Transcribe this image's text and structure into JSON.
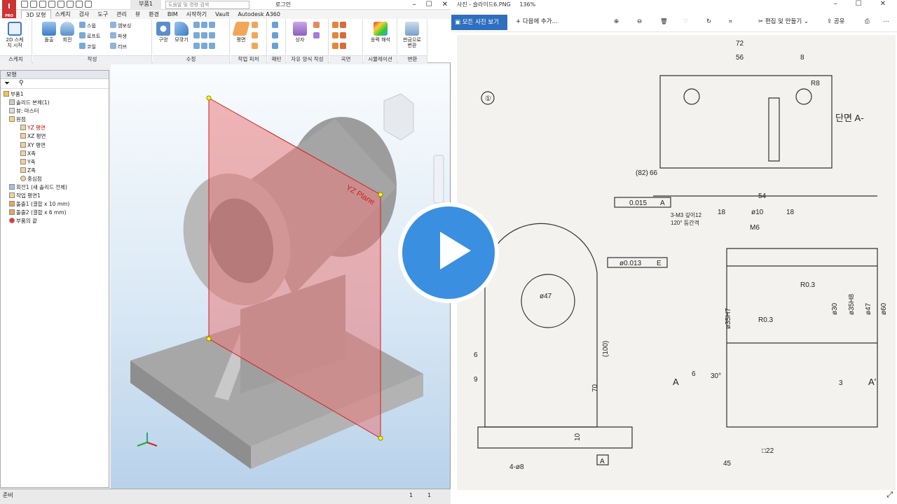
{
  "app": {
    "doc_title": "부품1",
    "search_placeholder": "도움말 및 명령 검색",
    "signin": "로그인",
    "window_controls": [
      "–",
      "☐",
      "✕"
    ]
  },
  "ribbon_tabs": [
    "3D 모형",
    "스케치",
    "검사",
    "도구",
    "관리",
    "뷰",
    "환경",
    "BIM",
    "시작하기",
    "Vault",
    "Autodesk A360"
  ],
  "ribbon": {
    "sketch": {
      "btn": "2D 스케치 시작",
      "label": "스케치"
    },
    "create": {
      "extrude": "돌출",
      "revolve": "회전",
      "sweep": "스윕",
      "loft": "로프트",
      "coil": "코일",
      "emboss": "엠보싱",
      "derive": "파생",
      "rib": "리브",
      "label": "작성"
    },
    "modify": {
      "hole": "구멍",
      "fillet": "모깎기",
      "label": "수정"
    },
    "work": {
      "plane": "평면",
      "label": "작업 피처"
    },
    "pattern": {
      "label": "패턴"
    },
    "freeform": {
      "box": "상자",
      "label": "자유 양식 작성"
    },
    "surface": {
      "label": "곡면"
    },
    "sim": {
      "stress": "응력 해석",
      "label": "시뮬레이션"
    },
    "convert": {
      "sheetmetal": "판금으로 변환",
      "label": "변환"
    }
  },
  "browser": {
    "title": "모형",
    "items": [
      "부품1",
      "솔리드 본체(1)",
      "뷰: 마스터",
      "원점",
      "YZ 평면",
      "XZ 평면",
      "XY 평면",
      "X축",
      "Y축",
      "Z축",
      "중심점",
      "회전1 (새 솔리드 전체)",
      "작업 평면1",
      "돌출1 (결합 x 10 mm)",
      "돌출2 (결합 x 6 mm)",
      "부품의 끝"
    ]
  },
  "viewport": {
    "plane_label": "YZ Plane"
  },
  "status": {
    "text": "준비",
    "n1": "1",
    "n2": "1"
  },
  "photos": {
    "title": "사진 - 슬라이드6.PNG",
    "zoom": "136%",
    "all_photos": "모든 사진 보기",
    "add_to": "다음에 추가...",
    "edit": "편집 및 만들기",
    "share": "공유"
  },
  "drawing": {
    "symbol_num": "①",
    "section_label": "단면 A-",
    "dims": [
      "72",
      "56",
      "8",
      "R8",
      "(82)",
      "66",
      "54",
      "18",
      "ø10",
      "18",
      "M6",
      "3-M3 깊이12",
      "120° 등간격",
      "0.015",
      "A",
      "ø0.013",
      "E",
      "ø47",
      "(100)",
      "70",
      "R0.3",
      "R0.3",
      "ø35H7",
      "ø30",
      "ø35H8",
      "ø47",
      "ø60",
      "6",
      "30°",
      "3",
      "10",
      "45",
      "□22",
      "9",
      "6",
      "4-ø8",
      "A",
      "A",
      "A'"
    ]
  },
  "colors": {
    "accent": "#2f6fbf",
    "plane": "#e77a7a",
    "model": "#b5b5b5"
  }
}
